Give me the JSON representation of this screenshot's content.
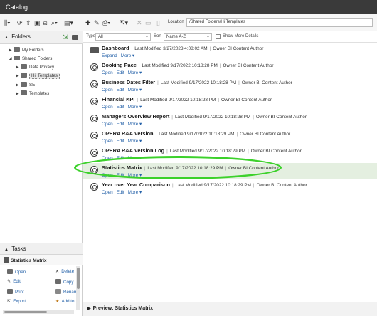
{
  "window": {
    "title": "Catalog"
  },
  "toolbar": {
    "location_label": "Location",
    "location_value": "/Shared Folders/Hi Templates"
  },
  "folders_panel": {
    "title": "Folders",
    "items": [
      {
        "label": "My Folders",
        "expanded": false
      },
      {
        "label": "Shared Folders",
        "expanded": true
      },
      {
        "label": "Data Privacy",
        "expanded": false
      },
      {
        "label": "Hil Templates",
        "expanded": false,
        "selected": true
      },
      {
        "label": "SE",
        "expanded": false
      },
      {
        "label": "Templates",
        "expanded": false
      }
    ]
  },
  "filter_bar": {
    "type_label": "Type",
    "type_value": "All",
    "sort_label": "Sort",
    "sort_value": "Name A-Z",
    "show_more_details_label": "Show More Details"
  },
  "items": [
    {
      "name": "Dashboard",
      "icon": "folder-icon",
      "modified": "Last Modified 3/27/2023 4:08:02 AM",
      "owner": "Owner BI Content Author",
      "actions": [
        "Expand",
        "More ▾"
      ]
    },
    {
      "name": "Booking Pace",
      "icon": "report-icon",
      "modified": "Last Modified 9/17/2022 10:18:28 PM",
      "owner": "Owner BI Content Author",
      "actions": [
        "Open",
        "Edit",
        "More ▾"
      ]
    },
    {
      "name": "Business Dates Filter",
      "icon": "report-icon",
      "modified": "Last Modified 9/17/2022 10:18:28 PM",
      "owner": "Owner BI Content Author",
      "actions": [
        "Open",
        "Edit",
        "More ▾"
      ]
    },
    {
      "name": "Financial KPI",
      "icon": "report-icon",
      "modified": "Last Modified 9/17/2022 10:18:28 PM",
      "owner": "Owner BI Content Author",
      "actions": [
        "Open",
        "Edit",
        "More ▾"
      ]
    },
    {
      "name": "Managers Overview Report",
      "icon": "report-icon",
      "modified": "Last Modified 9/17/2022 10:18:28 PM",
      "owner": "Owner BI Content Author",
      "actions": [
        "Open",
        "Edit",
        "More ▾"
      ]
    },
    {
      "name": "OPERA R&A Version",
      "icon": "report-icon",
      "modified": "Last Modified 9/17/2022 10:18:29 PM",
      "owner": "Owner BI Content Author",
      "actions": [
        "Open",
        "Edit",
        "More ▾"
      ]
    },
    {
      "name": "OPERA R&A Version Log",
      "icon": "report-icon",
      "modified": "Last Modified 9/17/2022 10:18:29 PM",
      "owner": "Owner BI Content Author",
      "actions": [
        "Open",
        "Edit",
        "More ▾"
      ]
    },
    {
      "name": "Statistics Matrix",
      "icon": "report-icon",
      "modified": "Last Modified 9/17/2022 10:18:29 PM",
      "owner": "Owner BI Content Author",
      "actions": [
        "Open",
        "Edit",
        "More ▾"
      ],
      "selected": true
    },
    {
      "name": "Year over Year Comparison",
      "icon": "report-icon",
      "modified": "Last Modified 9/17/2022 10:18:29 PM",
      "owner": "Owner BI Content Author",
      "actions": [
        "Open",
        "Edit",
        "More ▾"
      ]
    }
  ],
  "tasks_panel": {
    "title": "Tasks",
    "selected_item": "Statistics Matrix",
    "actions": [
      "Open",
      "Delete",
      "Edit",
      "Copy",
      "Print",
      "Renam",
      "Export",
      "Add to"
    ]
  },
  "preview": {
    "label": "Preview: Statistics Matrix"
  },
  "colors": {
    "highlight_oval": "#3cd12b",
    "link": "#2461a8",
    "selected_row": "#e4efe0"
  }
}
